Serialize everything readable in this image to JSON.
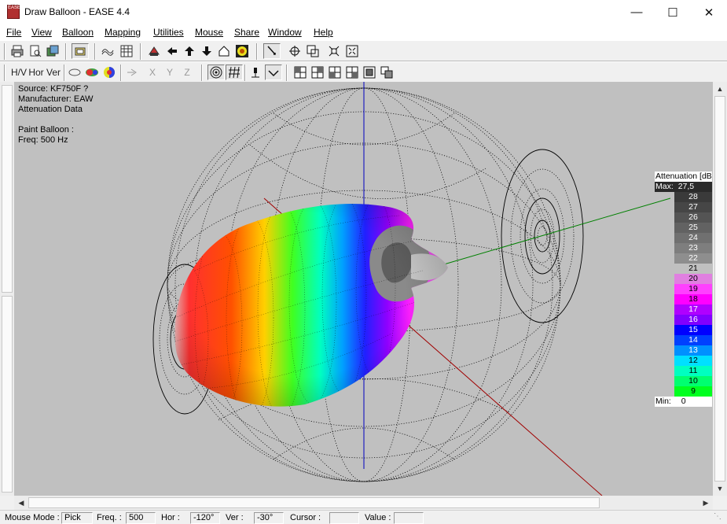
{
  "window": {
    "title": "Draw Balloon  - EASE 4.4",
    "app_icon_text": "EASE"
  },
  "menu": [
    "File",
    "View",
    "Balloon",
    "Mapping",
    "Utilities",
    "Mouse",
    "Share",
    "Window",
    "Help"
  ],
  "toolbar2": {
    "hv_label": "H/V",
    "hor_label": "Hor",
    "ver_label": "Ver",
    "x_label": "X",
    "y_label": "Y",
    "z_label": "Z"
  },
  "info": {
    "source": "Source: KF750F ?",
    "manufacturer": "Manufacturer: EAW",
    "data_type": "Attenuation Data",
    "paint_mode": "Paint Balloon :",
    "freq": "Freq: 500 Hz"
  },
  "legend": {
    "title": "Attenuation [dB]",
    "max_label": "Max:",
    "max_value": "27,5",
    "min_label": "Min:",
    "min_value": "0",
    "steps": [
      {
        "value": "28",
        "color": "#3a3a3a"
      },
      {
        "value": "27",
        "color": "#464646"
      },
      {
        "value": "26",
        "color": "#545454"
      },
      {
        "value": "25",
        "color": "#626262"
      },
      {
        "value": "24",
        "color": "#707070"
      },
      {
        "value": "23",
        "color": "#7e7e7e"
      },
      {
        "value": "22",
        "color": "#8e8e8e"
      },
      {
        "value": "21",
        "color": "#c0c0c0"
      },
      {
        "value": "20",
        "color": "#e080e0"
      },
      {
        "value": "19",
        "color": "#ff40ff"
      },
      {
        "value": "18",
        "color": "#ff00ff"
      },
      {
        "value": "17",
        "color": "#b000ff"
      },
      {
        "value": "16",
        "color": "#8000ff"
      },
      {
        "value": "15",
        "color": "#0000ff"
      },
      {
        "value": "14",
        "color": "#0040ff"
      },
      {
        "value": "13",
        "color": "#0090ff"
      },
      {
        "value": "12",
        "color": "#00e0ff"
      },
      {
        "value": "11",
        "color": "#00ffc0"
      },
      {
        "value": "10",
        "color": "#00ff70"
      },
      {
        "value": "9",
        "color": "#00ff20"
      }
    ]
  },
  "status": {
    "mouse_mode_label": "Mouse Mode :",
    "mouse_mode": "Pick",
    "freq_label": "Freq. :",
    "freq": "500",
    "hor_label": "Hor :",
    "hor": "-120°",
    "ver_label": "Ver :",
    "ver": "-30°",
    "cursor_label": "Cursor :",
    "cursor": "",
    "value_label": "Value :",
    "value": ""
  },
  "colors": {
    "canvas_bg": "#c0c0c0",
    "axis_z": "#0000c0",
    "axis_x": "#a00000",
    "axis_y": "#008000"
  }
}
